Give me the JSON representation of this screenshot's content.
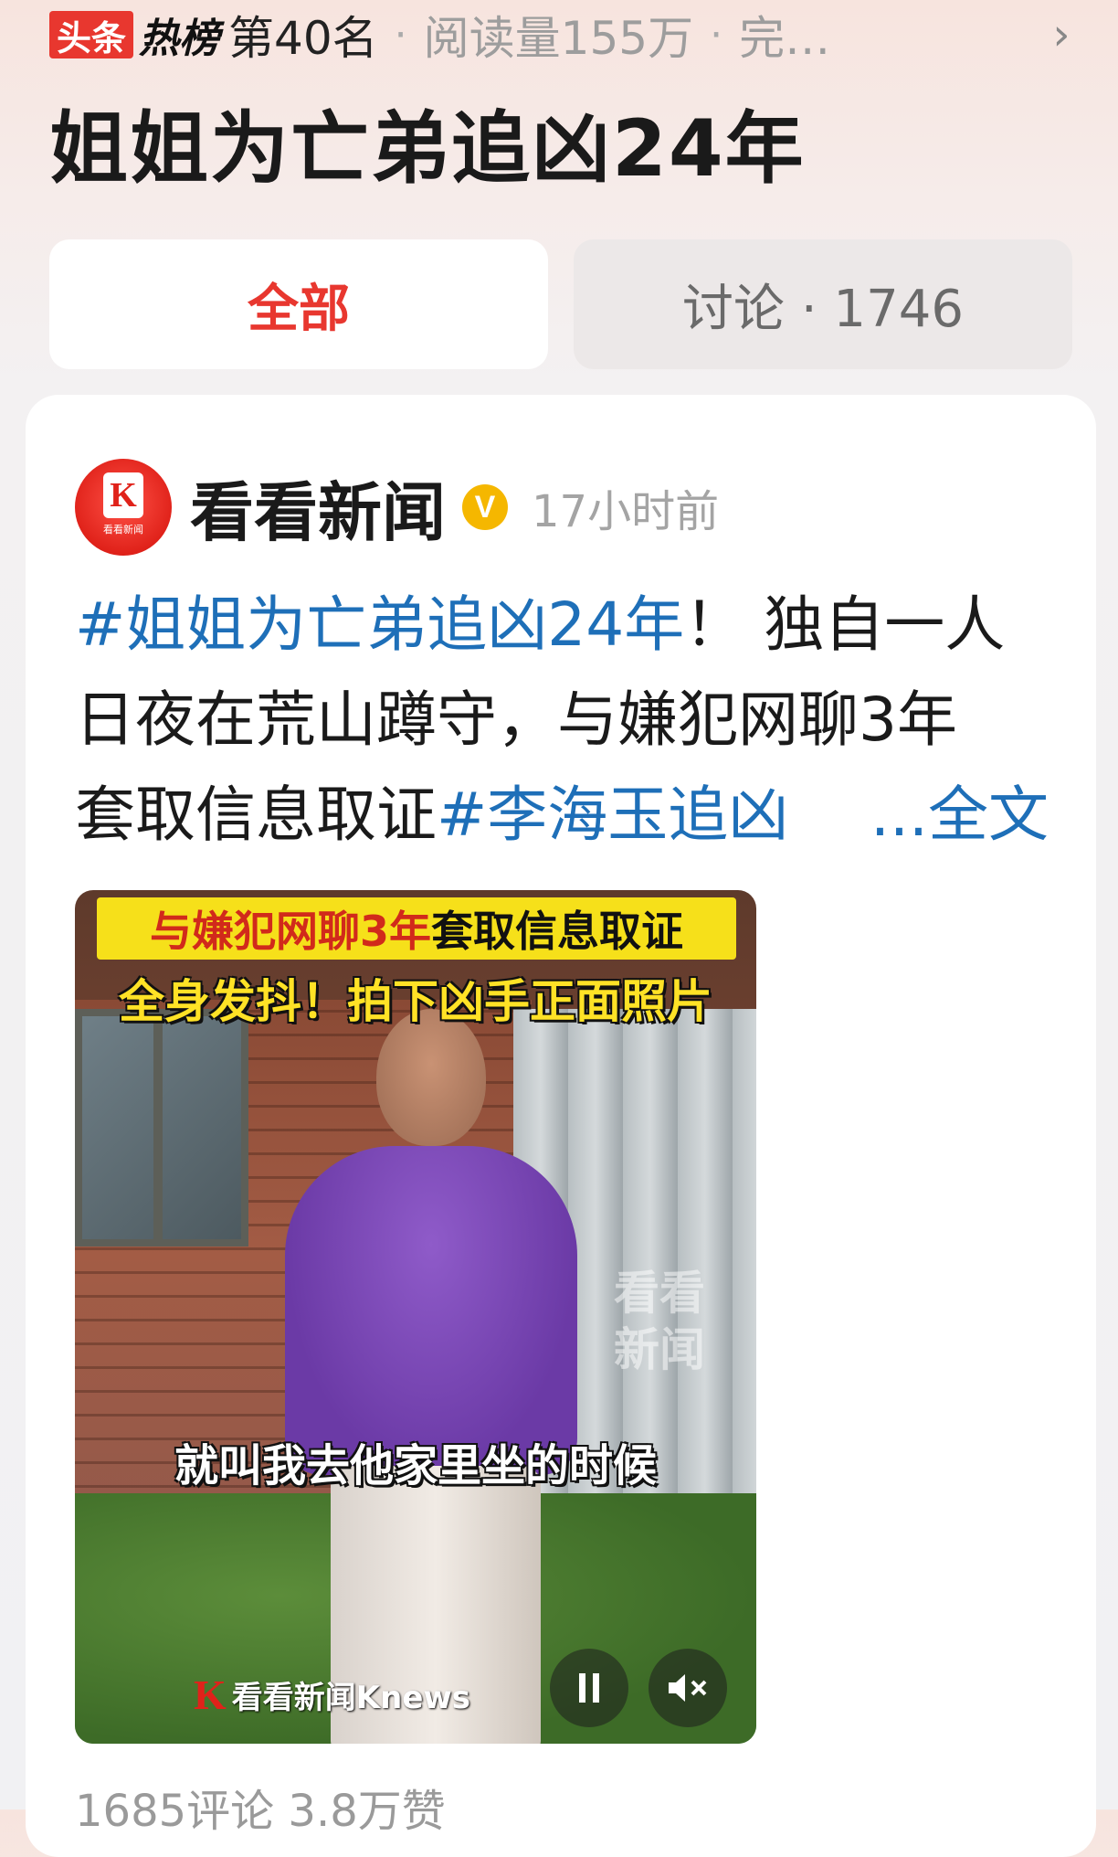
{
  "hot_header": {
    "logo_toutiao": "头条",
    "logo_hot": "热榜",
    "rank": "第40名",
    "reads": "阅读量155万",
    "status": "完…"
  },
  "topic_title": "姐姐为亡弟追凶24年",
  "tabs": [
    {
      "label": "全部",
      "active": true
    },
    {
      "label": "讨论 · 1746",
      "active": false
    }
  ],
  "post": {
    "author": "看看新闻",
    "avatar_caption": "看看新闻",
    "verified_badge": "V",
    "time": "17小时前",
    "text": {
      "tag1": "#姐姐为亡弟追凶24年",
      "line1_rest": "！ 独自一人",
      "line2": "日夜在荒山蹲守，与嫌犯网聊3年",
      "line3_lead": "套取信息取证",
      "tag2": "#李海玉追凶",
      "more": "...全文"
    },
    "video": {
      "caption_top_red": "与嫌犯网聊3年",
      "caption_top_black": "套取信息取证",
      "caption_sub": "全身发抖！拍下凶手正面照片",
      "subtitle": "就叫我去他家里坐的时候",
      "watermark_1": "看看",
      "watermark_2": "新闻",
      "logo_k": "K",
      "logo_text": "看看新闻Knews"
    },
    "stats": "1685评论  3.8万赞"
  },
  "colors": {
    "accent_red": "#e8372f",
    "tag_blue": "#1e6fb8",
    "verified_gold": "#f5b700"
  }
}
